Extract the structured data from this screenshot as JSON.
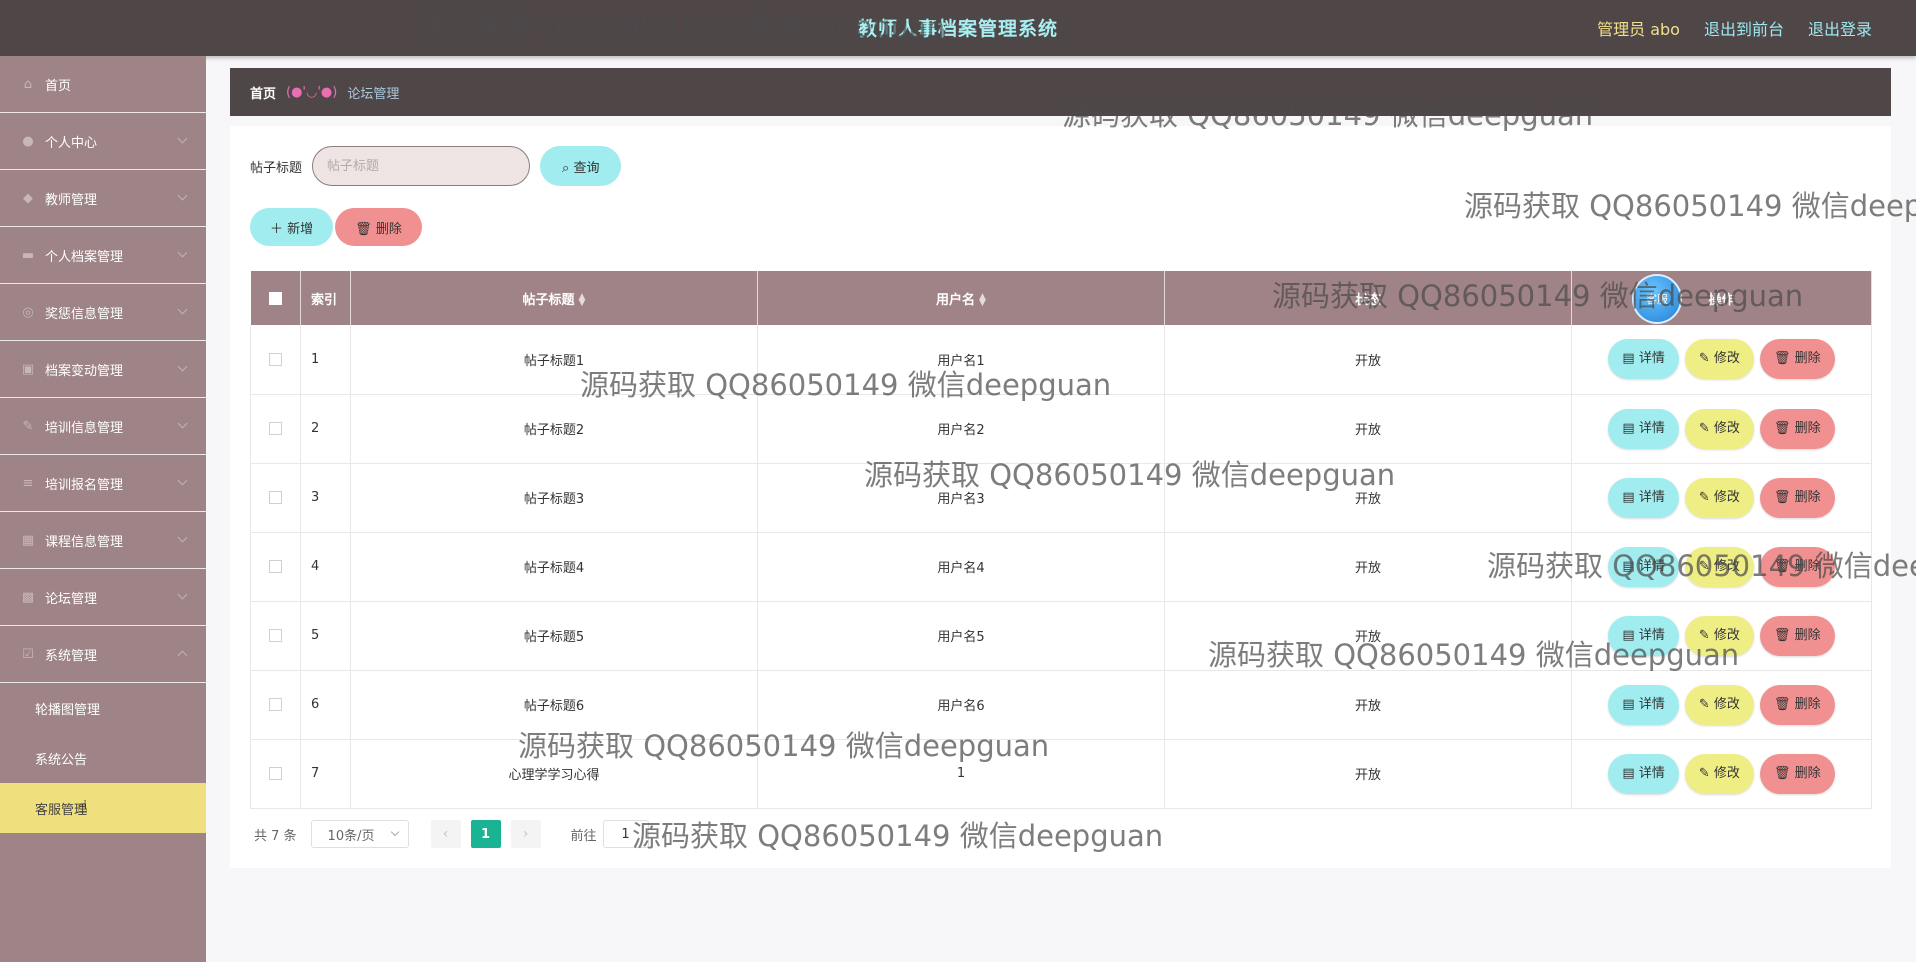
{
  "header": {
    "title": "教师人事档案管理系统",
    "admin_label": "管理员 abo",
    "to_front": "退出到前台",
    "logout": "退出登录"
  },
  "sidebar": {
    "items": [
      {
        "label": "首页",
        "icon": "home-icon"
      },
      {
        "label": "个人中心",
        "icon": "user-icon"
      },
      {
        "label": "教师管理",
        "icon": "teacher-icon"
      },
      {
        "label": "个人档案管理",
        "icon": "archive-icon"
      },
      {
        "label": "奖惩信息管理",
        "icon": "award-icon"
      },
      {
        "label": "档案变动管理",
        "icon": "change-icon"
      },
      {
        "label": "培训信息管理",
        "icon": "training-icon"
      },
      {
        "label": "培训报名管理",
        "icon": "signup-icon"
      },
      {
        "label": "课程信息管理",
        "icon": "course-icon"
      },
      {
        "label": "论坛管理",
        "icon": "forum-icon"
      },
      {
        "label": "系统管理",
        "icon": "system-icon"
      }
    ],
    "sub_items": [
      {
        "label": "轮播图管理"
      },
      {
        "label": "系统公告"
      },
      {
        "label": "客服管理"
      }
    ]
  },
  "breadcrumb": {
    "home": "首页",
    "separator": "(●'◡'●)",
    "current": "论坛管理"
  },
  "search": {
    "label": "帖子标题",
    "placeholder": "帖子标题",
    "button": "查询"
  },
  "actions": {
    "add": "新增",
    "delete": "删除"
  },
  "table": {
    "headers": {
      "index": "索引",
      "title": "帖子标题",
      "user": "用户名",
      "status": "状态",
      "ops": "操作"
    },
    "ops": {
      "detail": "详情",
      "edit": "修改",
      "delete": "删除"
    },
    "rows": [
      {
        "index": "1",
        "title": "帖子标题1",
        "user": "用户名1",
        "status": "开放"
      },
      {
        "index": "2",
        "title": "帖子标题2",
        "user": "用户名2",
        "status": "开放"
      },
      {
        "index": "3",
        "title": "帖子标题3",
        "user": "用户名3",
        "status": "开放"
      },
      {
        "index": "4",
        "title": "帖子标题4",
        "user": "用户名4",
        "status": "开放"
      },
      {
        "index": "5",
        "title": "帖子标题5",
        "user": "用户名5",
        "status": "开放"
      },
      {
        "index": "6",
        "title": "帖子标题6",
        "user": "用户名6",
        "status": "开放"
      },
      {
        "index": "7",
        "title": "心理学学习心得",
        "user": "1",
        "status": "开放"
      }
    ]
  },
  "pager": {
    "total": "共 7 条",
    "page_size": "10条/页",
    "current_page": "1",
    "goto_label": "前往",
    "goto_value": "1"
  },
  "watermark": {
    "text": "源码获取 QQ86050149 微信deepguan"
  },
  "chat": {
    "label": "客服"
  },
  "colors": {
    "topbar": "#4f4648",
    "sidebar": "#9e8486",
    "active_item": "#efdf7d",
    "table_header": "#a08386",
    "cyan_button": "#a0ecef",
    "yellow_button": "#efee84",
    "red_button": "#f09090",
    "current_page": "#1ab394"
  }
}
